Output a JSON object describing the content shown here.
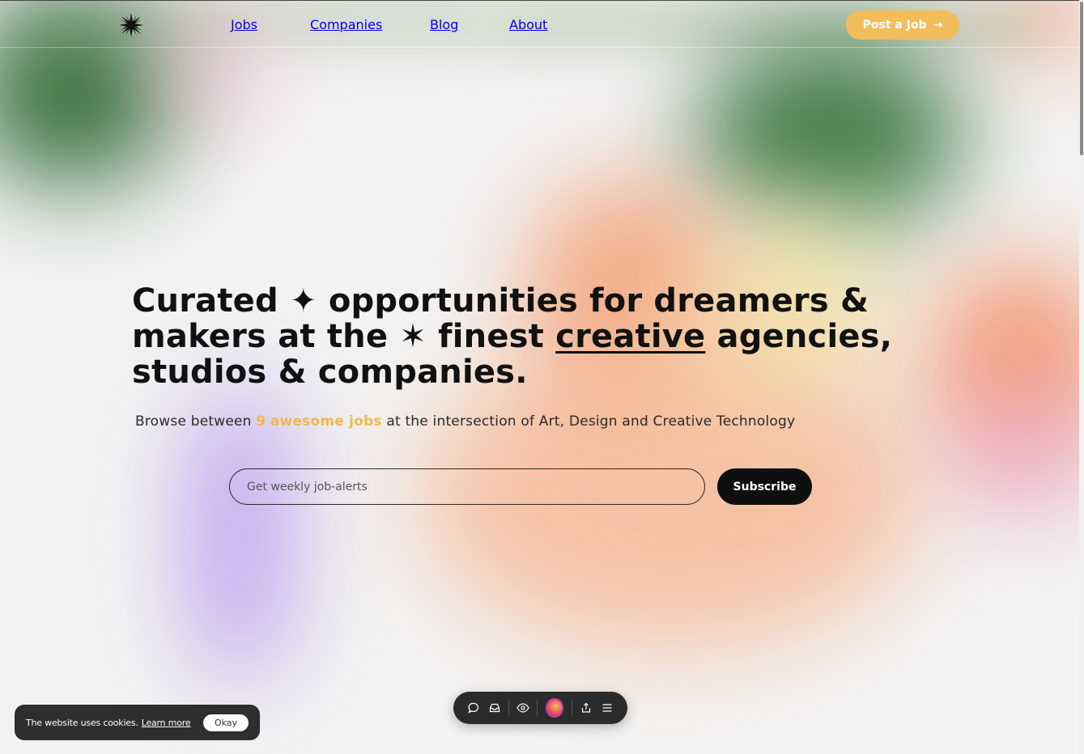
{
  "header": {
    "nav": [
      "Jobs",
      "Companies",
      "Blog",
      "About"
    ],
    "post_button": "Post a Job",
    "post_arrow": "→"
  },
  "hero": {
    "line1_a": "Curated",
    "line1_star": "✦",
    "line1_b": "opportunities for dreamers &",
    "line2_a": "makers at the",
    "line2_star": "✶",
    "line2_b": "finest",
    "line2_u": "creative",
    "line2_c": "agencies,",
    "line3": "studios & companies.",
    "sub_a": "Browse between",
    "sub_count": "9",
    "sub_hl": "awesome jobs",
    "sub_b": "at the intersection of Art, Design and Creative Technology"
  },
  "signup": {
    "placeholder": "Get weekly job-alerts",
    "button": "Subscribe"
  },
  "toolbar": {
    "icons": [
      "comment-icon",
      "inbox-icon",
      "eye-icon",
      "avatar",
      "share-icon",
      "menu-icon"
    ]
  },
  "cookie": {
    "text": "The website uses cookies.",
    "link": "Learn more",
    "button": "Okay"
  },
  "colors": {
    "accent": "#f3bd5c",
    "highlight": "#f0b94d",
    "dark": "#0f0f0f"
  }
}
